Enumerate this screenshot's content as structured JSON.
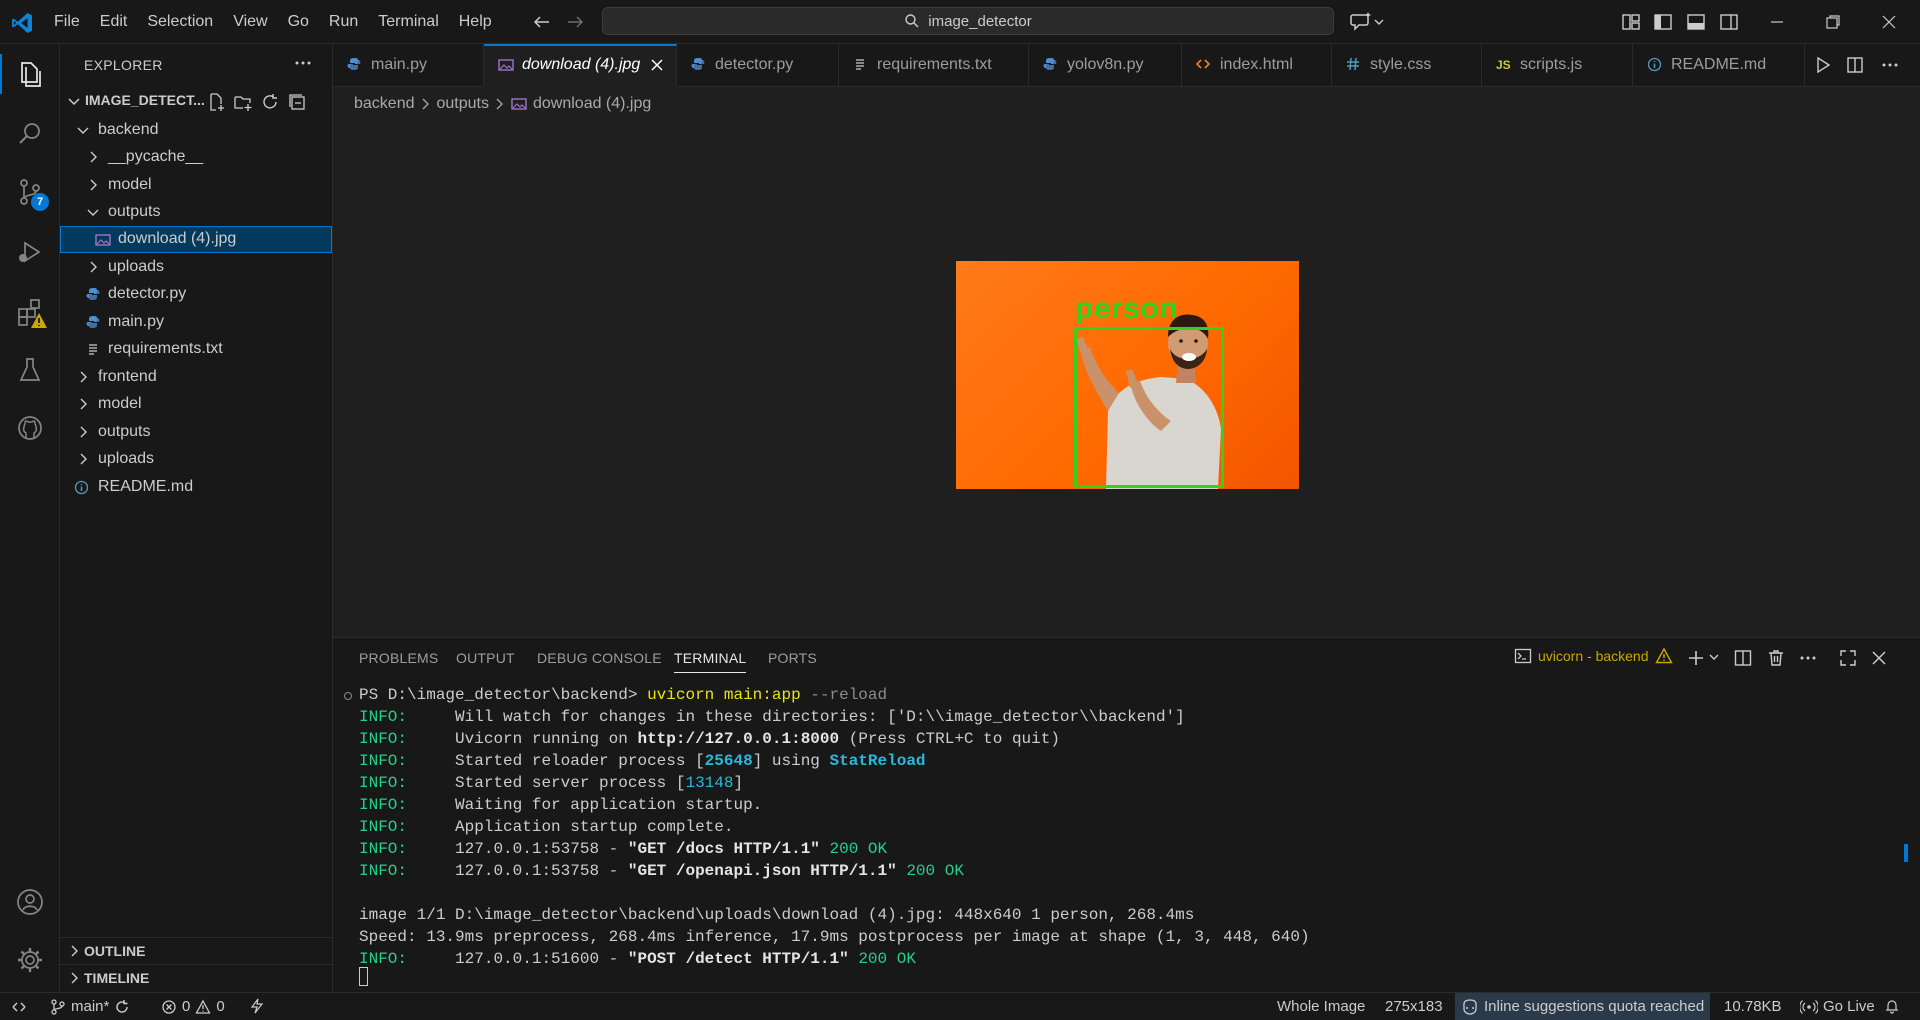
{
  "menu": [
    "File",
    "Edit",
    "Selection",
    "View",
    "Go",
    "Run",
    "Terminal",
    "Help"
  ],
  "command_center": {
    "text": "image_detector"
  },
  "activity": {
    "scm_badge": "7"
  },
  "sidebar": {
    "title": "EXPLORER",
    "folder": "IMAGE_DETECT...",
    "tree": [
      {
        "label": "backend",
        "kind": "folder-open"
      },
      {
        "label": "__pycache__",
        "kind": "folder"
      },
      {
        "label": "model",
        "kind": "folder"
      },
      {
        "label": "outputs",
        "kind": "folder-open"
      },
      {
        "label": "download (4).jpg",
        "kind": "image",
        "selected": true
      },
      {
        "label": "uploads",
        "kind": "folder"
      },
      {
        "label": "detector.py",
        "kind": "python"
      },
      {
        "label": "main.py",
        "kind": "python"
      },
      {
        "label": "requirements.txt",
        "kind": "text"
      },
      {
        "label": "frontend",
        "kind": "folder"
      },
      {
        "label": "model",
        "kind": "folder"
      },
      {
        "label": "outputs",
        "kind": "folder"
      },
      {
        "label": "uploads",
        "kind": "folder"
      },
      {
        "label": "README.md",
        "kind": "info"
      }
    ],
    "outline": "OUTLINE",
    "timeline": "TIMELINE"
  },
  "tabs": [
    {
      "label": "main.py",
      "icon": "python-icon"
    },
    {
      "label": "download (4).jpg",
      "icon": "image-icon",
      "active": true
    },
    {
      "label": "detector.py",
      "icon": "python-icon"
    },
    {
      "label": "requirements.txt",
      "icon": "text-file-icon"
    },
    {
      "label": "yolov8n.py",
      "icon": "python-icon"
    },
    {
      "label": "index.html",
      "icon": "html-icon"
    },
    {
      "label": "style.css",
      "icon": "css-icon"
    },
    {
      "label": "scripts.js",
      "icon": "js-icon"
    },
    {
      "label": "README.md",
      "icon": "info-icon"
    }
  ],
  "breadcrumb": {
    "part1": "backend",
    "part2": "outputs",
    "file": "download (4).jpg"
  },
  "preview": {
    "detection_label": "person"
  },
  "panel": {
    "tabs": [
      "PROBLEMS",
      "OUTPUT",
      "DEBUG CONSOLE",
      "TERMINAL",
      "PORTS"
    ],
    "active_tab": "TERMINAL",
    "terminal_name": "uvicorn - backend"
  },
  "terminal": {
    "prompt": "PS D:\\image_detector\\backend>",
    "cmd": "uvicorn main:app",
    "cmd_flag": "--reload",
    "info": "INFO:",
    "l1": "Will watch for changes in these directories: ['D:\\\\image_detector\\\\backend']",
    "l2_a": "Uvicorn running on ",
    "l2_url": "http://127.0.0.1:8000",
    "l2_b": " (Press CTRL+C to quit)",
    "l3_a": "Started reloader process [",
    "l3_pid": "25648",
    "l3_b": "] using ",
    "l3_c": "StatReload",
    "l4_a": "Started server process [",
    "l4_pid": "13148",
    "l4_b": "]",
    "l5": "Waiting for application startup.",
    "l6": "Application startup complete.",
    "l7_a": "127.0.0.1:53758 - ",
    "l7_req": "\"GET /docs HTTP/1.1\"",
    "l7_status": "200 OK",
    "l8_a": "127.0.0.1:53758 - ",
    "l8_req": "\"GET /openapi.json HTTP/1.1\"",
    "l8_status": "200 OK",
    "l9": "image 1/1 D:\\image_detector\\backend\\uploads\\download (4).jpg: 448x640 1 person, 268.4ms",
    "l10": "Speed: 13.9ms preprocess, 268.4ms inference, 17.9ms postprocess per image at shape (1, 3, 448, 640)",
    "l11_a": "127.0.0.1:51600 - ",
    "l11_req": "\"POST /detect HTTP/1.1\"",
    "l11_status": "200 OK"
  },
  "status": {
    "branch": "main*",
    "errors": "0",
    "warnings": "0",
    "zoom": "Whole Image",
    "dimensions": "275x183",
    "quota": "Inline suggestions quota reached",
    "size": "10.78KB",
    "golive": "Go Live"
  },
  "colors": {
    "accent": "#0078d4",
    "detection": "#33d11e",
    "image_bg": "#ff6a00"
  }
}
